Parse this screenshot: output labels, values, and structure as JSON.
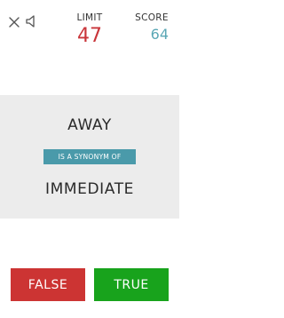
{
  "header": {
    "close_icon": "close-icon",
    "sound_icon": "speaker-icon",
    "limit": {
      "label": "LIMIT",
      "value": "47"
    },
    "score": {
      "label": "SCORE",
      "value": "64"
    }
  },
  "card": {
    "word_top": "AWAY",
    "relation": "IS A SYNONYM OF",
    "word_bottom": "IMMEDIATE"
  },
  "answers": {
    "false_label": "FALSE",
    "true_label": "TRUE"
  },
  "colors": {
    "limit": "#c9353a",
    "score": "#5aa7b5",
    "relation_badge": "#4a9aaa",
    "false_button": "#cc3433",
    "true_button": "#18a31c",
    "card_background": "#ececec"
  }
}
